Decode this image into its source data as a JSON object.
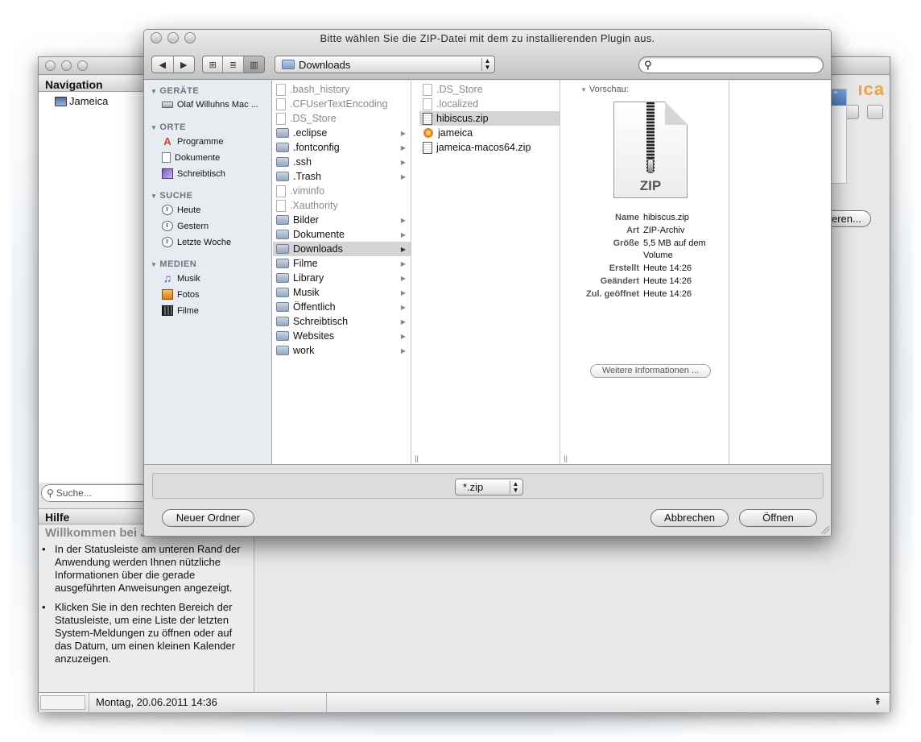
{
  "dialog": {
    "title": "Bitte wählen Sie die ZIP-Datei mit dem zu installierenden Plugin aus.",
    "back_label": "◀",
    "forward_label": "▶",
    "view_icon_label": "⊞",
    "view_list_label": "≣",
    "view_column_label": "▥",
    "location": "Downloads",
    "search_placeholder": "",
    "filter": "*.zip",
    "new_folder_label": "Neuer Ordner",
    "cancel_label": "Abbrechen",
    "open_label": "Öffnen"
  },
  "sidebar": {
    "sections": [
      {
        "title": "GERÄTE",
        "items": [
          {
            "label": "Olaf Willuhns Mac ...",
            "icon": "hard-drive-icon"
          }
        ]
      },
      {
        "title": "ORTE",
        "items": [
          {
            "label": "Programme",
            "icon": "applications-icon"
          },
          {
            "label": "Dokumente",
            "icon": "documents-icon"
          },
          {
            "label": "Schreibtisch",
            "icon": "desktop-icon"
          }
        ]
      },
      {
        "title": "SUCHE",
        "items": [
          {
            "label": "Heute",
            "icon": "clock-icon"
          },
          {
            "label": "Gestern",
            "icon": "clock-icon"
          },
          {
            "label": "Letzte Woche",
            "icon": "clock-icon"
          }
        ]
      },
      {
        "title": "MEDIEN",
        "items": [
          {
            "label": "Musik",
            "icon": "music-icon"
          },
          {
            "label": "Fotos",
            "icon": "photos-icon"
          },
          {
            "label": "Filme",
            "icon": "movies-icon"
          }
        ]
      }
    ]
  },
  "column1": [
    {
      "name": ".bash_history",
      "type": "file",
      "dim": true
    },
    {
      "name": ".CFUserTextEncoding",
      "type": "file",
      "dim": true
    },
    {
      "name": ".DS_Store",
      "type": "file",
      "dim": true
    },
    {
      "name": ".eclipse",
      "type": "folder",
      "dim": false
    },
    {
      "name": ".fontconfig",
      "type": "folder",
      "dim": false
    },
    {
      "name": ".ssh",
      "type": "folder",
      "dim": false
    },
    {
      "name": ".Trash",
      "type": "folder",
      "dim": false
    },
    {
      "name": ".viminfo",
      "type": "file",
      "dim": true
    },
    {
      "name": ".Xauthority",
      "type": "file",
      "dim": true
    },
    {
      "name": "Bilder",
      "type": "folder",
      "dim": false
    },
    {
      "name": "Dokumente",
      "type": "folder",
      "dim": false
    },
    {
      "name": "Downloads",
      "type": "folder",
      "dim": false,
      "selected": true
    },
    {
      "name": "Filme",
      "type": "folder",
      "dim": false
    },
    {
      "name": "Library",
      "type": "folder",
      "dim": false
    },
    {
      "name": "Musik",
      "type": "folder",
      "dim": false
    },
    {
      "name": "Öffentlich",
      "type": "folder",
      "dim": false
    },
    {
      "name": "Schreibtisch",
      "type": "folder",
      "dim": false
    },
    {
      "name": "Websites",
      "type": "folder",
      "dim": false
    },
    {
      "name": "work",
      "type": "folder",
      "dim": false
    }
  ],
  "column2": [
    {
      "name": ".DS_Store",
      "type": "file",
      "dim": true
    },
    {
      "name": ".localized",
      "type": "file",
      "dim": true
    },
    {
      "name": "hibiscus.zip",
      "type": "zip",
      "dim": false,
      "selected": true
    },
    {
      "name": "jameica",
      "type": "app",
      "dim": false
    },
    {
      "name": "jameica-macos64.zip",
      "type": "zip",
      "dim": false
    }
  ],
  "preview": {
    "label": "Vorschau:",
    "icon_text": "ZIP",
    "rows": [
      {
        "key": "Name",
        "value": "hibiscus.zip"
      },
      {
        "key": "Art",
        "value": "ZIP-Archiv"
      },
      {
        "key": "Größe",
        "value": "5,5 MB auf dem Volume"
      },
      {
        "key": "Erstellt",
        "value": "Heute 14:26"
      },
      {
        "key": "Geändert",
        "value": "Heute 14:26"
      },
      {
        "key": "Zul. geöffnet",
        "value": "Heute 14:26"
      }
    ],
    "more_label": "Weitere Informationen ..."
  },
  "app": {
    "navigation_title": "Navigation",
    "nav_item": "Jameica",
    "logo_fragment": "ıca",
    "search_placeholder": "Suche...",
    "help_title": "Hilfe",
    "help_heading": "Willkommen bei Jameica",
    "help_items": [
      "In der Statusleiste am unteren Rand der Anwendung werden Ihnen nützliche Informationen über die gerade ausgeführten Anweisungen angezeigt.",
      "Klicken Sie in den rechten Bereich der Statusleiste, um eine Liste der letzten System-Meldungen zu öffnen oder auf das Datum, um einen kleinen Kalender anzuzeigen."
    ],
    "peek_button": "eren...",
    "status_date": "Montag, 20.06.2011 14:36",
    "status_toggle": "⇞"
  }
}
